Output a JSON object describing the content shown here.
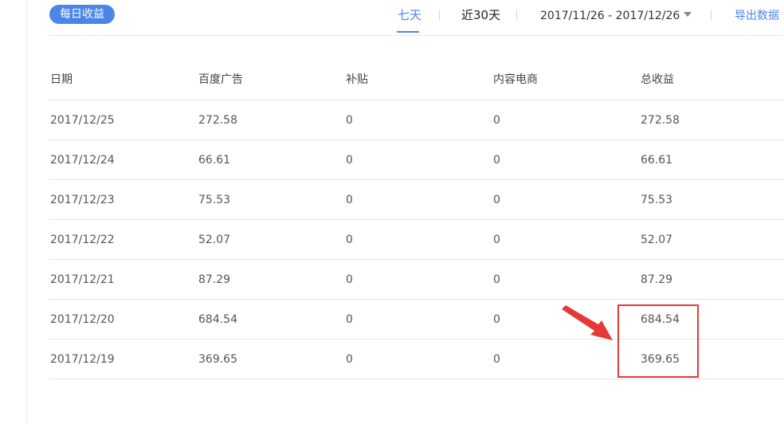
{
  "toolbar": {
    "badge_label": "每日收益",
    "tab_7d_label": "七天",
    "tab_30d_label": "近30天",
    "date_range": "2017/11/26 - 2017/12/26",
    "export_label": "导出数据"
  },
  "table": {
    "headers": [
      "日期",
      "百度广告",
      "补贴",
      "内容电商",
      "总收益"
    ],
    "rows": [
      [
        "2017/12/25",
        "272.58",
        "0",
        "0",
        "272.58"
      ],
      [
        "2017/12/24",
        "66.61",
        "0",
        "0",
        "66.61"
      ],
      [
        "2017/12/23",
        "75.53",
        "0",
        "0",
        "75.53"
      ],
      [
        "2017/12/22",
        "52.07",
        "0",
        "0",
        "52.07"
      ],
      [
        "2017/12/21",
        "87.29",
        "0",
        "0",
        "87.29"
      ],
      [
        "2017/12/20",
        "684.54",
        "0",
        "0",
        "684.54"
      ],
      [
        "2017/12/19",
        "369.65",
        "0",
        "0",
        "369.65"
      ]
    ]
  },
  "annotation": {
    "color": "#e53935",
    "highlighted_values": [
      "684.54",
      "369.65"
    ]
  },
  "colors": {
    "accent": "#4a86e8",
    "text": "#555555",
    "divider": "#e6e6e6"
  }
}
